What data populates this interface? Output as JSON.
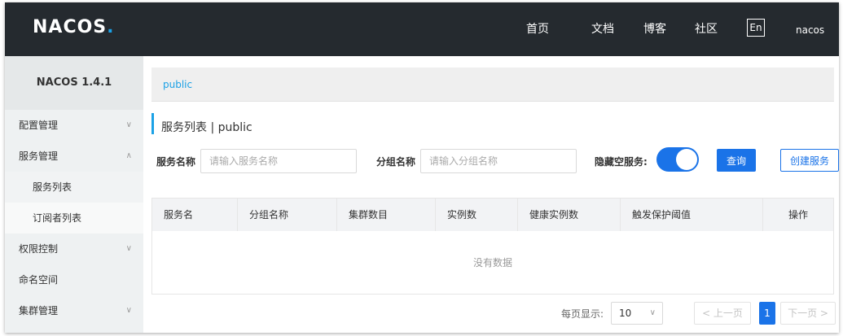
{
  "header": {
    "logo": "NACOS",
    "logo_dot": ".",
    "nav": [
      "首页",
      "文档",
      "博客",
      "社区"
    ],
    "lang": "En",
    "user": "nacos"
  },
  "sidebar": {
    "version": "NACOS 1.4.1",
    "items": [
      {
        "label": "配置管理",
        "chevron": "chevron-down-icon"
      },
      {
        "label": "服务管理",
        "chevron": "chevron-up-icon"
      },
      {
        "label": "服务列表"
      },
      {
        "label": "订阅者列表"
      },
      {
        "label": "权限控制",
        "chevron": "chevron-down-icon"
      },
      {
        "label": "命名空间"
      },
      {
        "label": "集群管理",
        "chevron": "chevron-down-icon"
      }
    ]
  },
  "main": {
    "namespace": "public",
    "title": "服务列表 | public",
    "filters": {
      "service_label": "服务名称",
      "service_placeholder": "请输入服务名称",
      "group_label": "分组名称",
      "group_placeholder": "请输入分组名称",
      "hide_empty_label": "隐藏空服务:",
      "hide_empty_on": true,
      "query_button": "查询",
      "create_button": "创建服务"
    },
    "table": {
      "columns": [
        "服务名",
        "分组名称",
        "集群数目",
        "实例数",
        "健康实例数",
        "触发保护阈值",
        "操作"
      ],
      "rows": [],
      "empty_text": "没有数据"
    },
    "pagination": {
      "page_size_label": "每页显示:",
      "page_size": "10",
      "prev": "< 上一页",
      "current_page": "1",
      "next": "下一页 >"
    }
  },
  "colors": {
    "topbar": "#252a2f",
    "accent": "#1a73e8",
    "link": "#1ba1e6",
    "sidebar": "#eef1f2"
  }
}
